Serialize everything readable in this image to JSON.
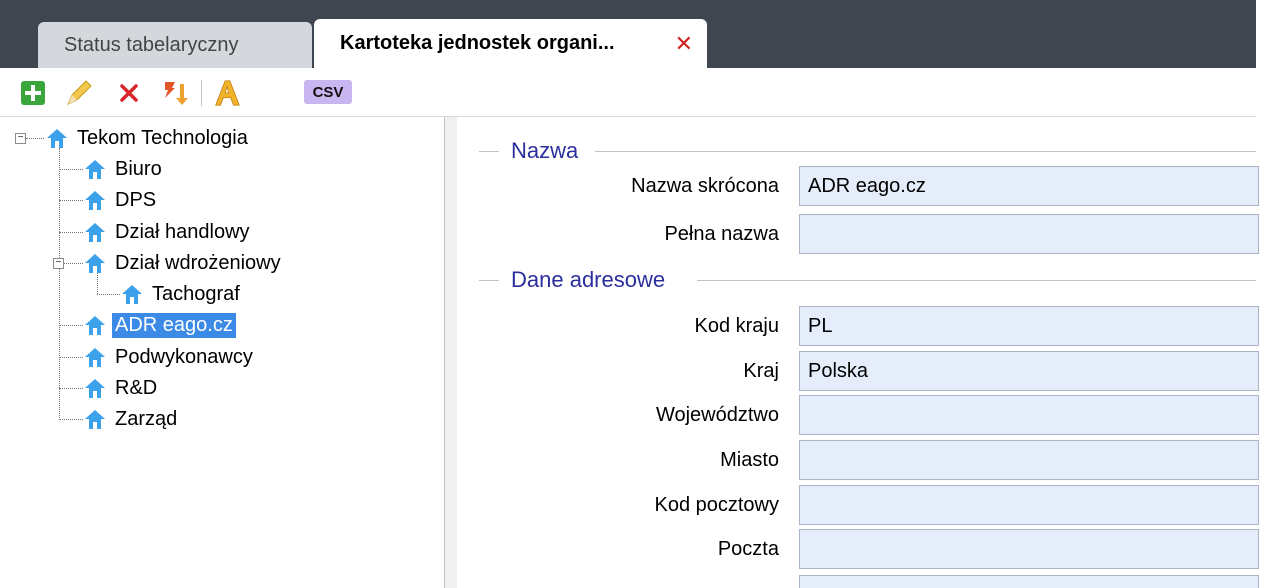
{
  "tabs": [
    {
      "label": "Status tabelaryczny",
      "active": false
    },
    {
      "label": "Kartoteka jednostek organi...",
      "active": true,
      "close": "✕"
    }
  ],
  "toolbar": {
    "icons": [
      "add-icon",
      "edit-icon",
      "delete-icon",
      "sort-icon",
      "font-icon",
      "csv-export-icon"
    ],
    "csv_label": "CSV"
  },
  "tree": {
    "root": "Tekom Technologia",
    "nodes": [
      "Biuro",
      "DPS",
      "Dział handlowy",
      "Dział wdrożeniowy",
      "Tachograf",
      "ADR eago.cz",
      "Podwykonawcy",
      "R&D",
      "Zarząd"
    ],
    "selected": "ADR eago.cz"
  },
  "detail": {
    "section_nazwa": "Nazwa",
    "section_adres": "Dane adresowe",
    "labels": {
      "short_name": "Nazwa skrócona",
      "full_name": "Pełna nazwa",
      "country_code": "Kod kraju",
      "country": "Kraj",
      "voivodeship": "Województwo",
      "city": "Miasto",
      "postal_code": "Kod pocztowy",
      "post_office": "Poczta"
    },
    "values": {
      "short_name": "ADR eago.cz",
      "full_name": "",
      "country_code": "PL",
      "country": "Polska",
      "voivodeship": "",
      "city": "",
      "postal_code": "",
      "post_office": ""
    }
  },
  "colors": {
    "tab_bar": "#3f4650",
    "selection": "#3b8be6",
    "section_title": "#2b2f9e",
    "field_bg": "#e5edfb",
    "close": "#d22323"
  }
}
